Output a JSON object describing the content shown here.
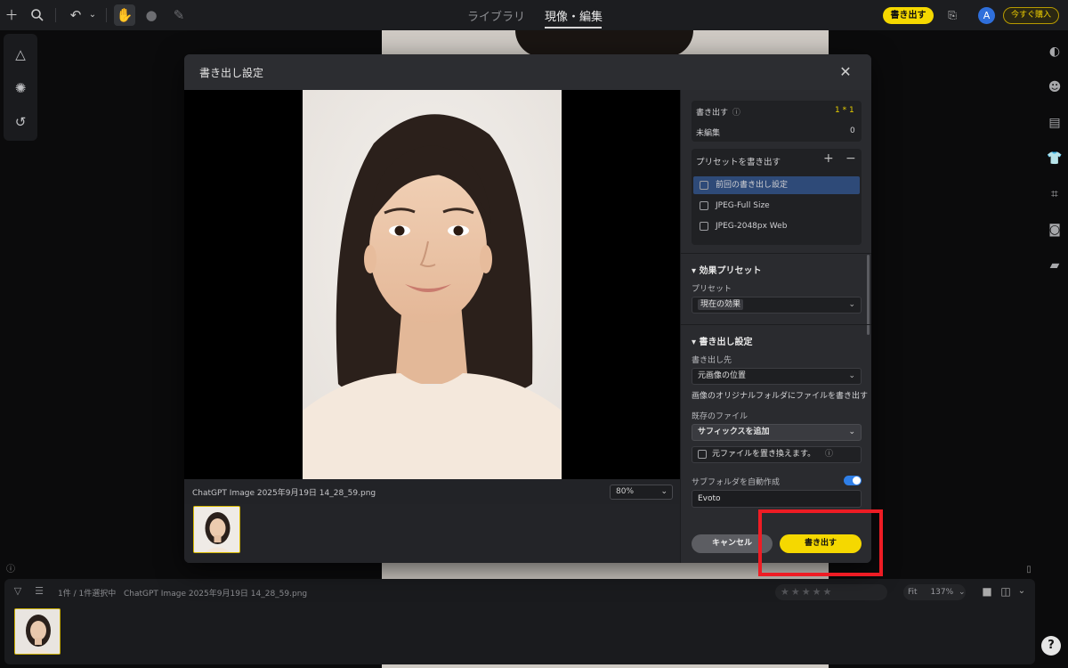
{
  "topbar": {
    "tab_library": "ライブラリ",
    "tab_edit": "現像・編集",
    "export_label": "書き出す",
    "avatar_letter": "A",
    "buy_label": "今すぐ購入"
  },
  "filmstrip": {
    "count_text": "1件 / 1件選択中",
    "filename": "ChatGPT Image 2025年9月19日 14_28_59.png",
    "fit_label": "Fit",
    "zoom_label": "137%",
    "rating_stars": 5
  },
  "dialog": {
    "title": "書き出し設定",
    "preview": {
      "filename": "ChatGPT Image 2025年9月19日 14_28_59.png",
      "zoom": "80%"
    },
    "summary": {
      "export_label": "書き出す",
      "export_value": "1 * 1",
      "unedited_label": "未編集",
      "unedited_value": "0"
    },
    "presets": {
      "title": "プリセットを書き出す",
      "add": "+",
      "remove": "−",
      "items": [
        {
          "label": "前回の書き出し設定",
          "selected": true
        },
        {
          "label": "JPEG-Full Size",
          "selected": false
        },
        {
          "label": "JPEG-2048px Web",
          "selected": false
        }
      ]
    },
    "effect_preset": {
      "section_title": "効果プリセット",
      "preset_label": "プリセット",
      "preset_value": "現在の効果"
    },
    "export_settings": {
      "section_title": "書き出し設定",
      "destination_label": "書き出し先",
      "destination_value": "元画像の位置",
      "destination_hint": "画像のオリジナルフォルダにファイルを書き出す",
      "existing_label": "既存のファイル",
      "existing_value": "サフィックスを追加",
      "replace_label": "元ファイルを置き換えます。",
      "subfolder_label": "サブフォルダを自動作成",
      "subfolder_enabled": true,
      "subfolder_value": "Evoto"
    },
    "cancel_label": "キャンセル",
    "export_label": "書き出す"
  },
  "colors": {
    "accent_yellow": "#f5d800",
    "highlight_red": "#ee1c24",
    "toggle_blue": "#2f7fe8"
  }
}
